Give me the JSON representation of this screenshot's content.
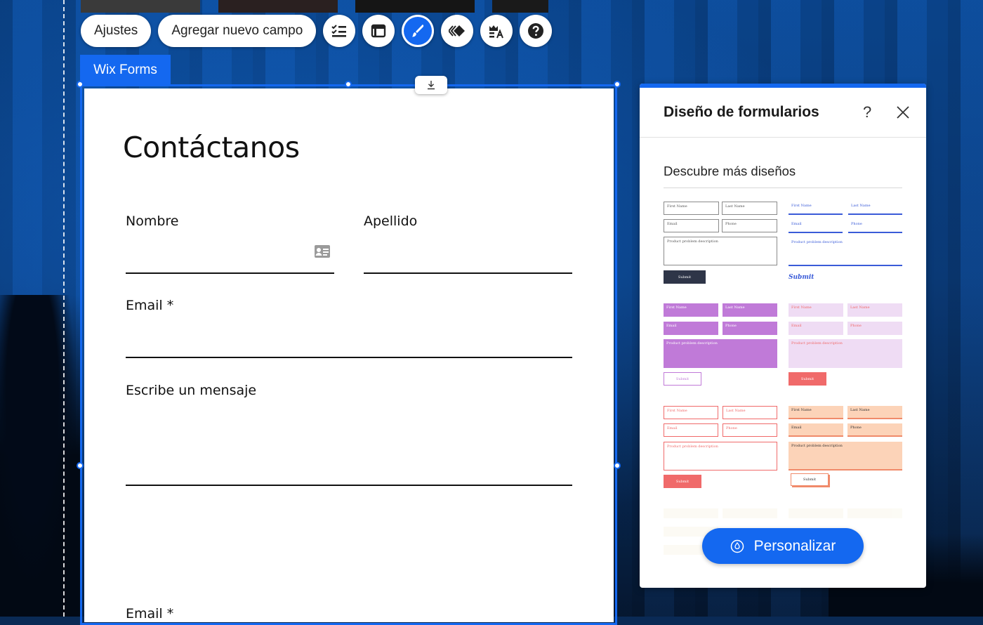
{
  "toolbar": {
    "settings_label": "Ajustes",
    "add_field_label": "Agregar nuevo campo",
    "icons": [
      "checklist-icon",
      "layout-icon",
      "brush-icon",
      "animation-icon",
      "crown-text-icon",
      "help-icon"
    ]
  },
  "form_tab_label": "Wix Forms",
  "form": {
    "title": "Contáctanos",
    "fields": {
      "first_name": "Nombre",
      "last_name": "Apellido",
      "email": "Email *",
      "message": "Escribe un mensaje",
      "email_repeat": "Email *"
    }
  },
  "panel": {
    "title": "Diseño de formularios",
    "help": "?",
    "subtitle": "Descubre más diseños",
    "templates": [
      {
        "first": "First Name",
        "last": "Last Name",
        "email": "Email",
        "phone": "Phone",
        "msg": "Product problem description",
        "submit": "Submit"
      },
      {
        "first": "First Name",
        "last": "Last Name",
        "email": "Email",
        "phone": "Phone",
        "msg": "Product problem description",
        "submit": "Submit"
      },
      {
        "first": "First Name",
        "last": "Last Name",
        "email": "Email",
        "phone": "Phone",
        "msg": "Product problem description",
        "submit": "Submit"
      },
      {
        "first": "First Name",
        "last": "Last Name",
        "email": "Email",
        "phone": "Phone",
        "msg": "Product problem description",
        "submit": "Submit"
      },
      {
        "first": "First Name",
        "last": "Last Name",
        "email": "Email",
        "phone": "Phone",
        "msg": "Product problem description",
        "submit": "Submit"
      },
      {
        "first": "First Name",
        "last": "Last Name",
        "email": "Email",
        "phone": "Phone",
        "msg": "Product problem description",
        "submit": "Submit"
      }
    ],
    "cta_label": "Personalizar"
  },
  "colors": {
    "accent": "#1468f0",
    "purple": "#c07ad8",
    "lavender": "#efdcf4",
    "coral": "#f06a6a",
    "peach": "#fcd3b8",
    "navy": "#2e3548"
  }
}
